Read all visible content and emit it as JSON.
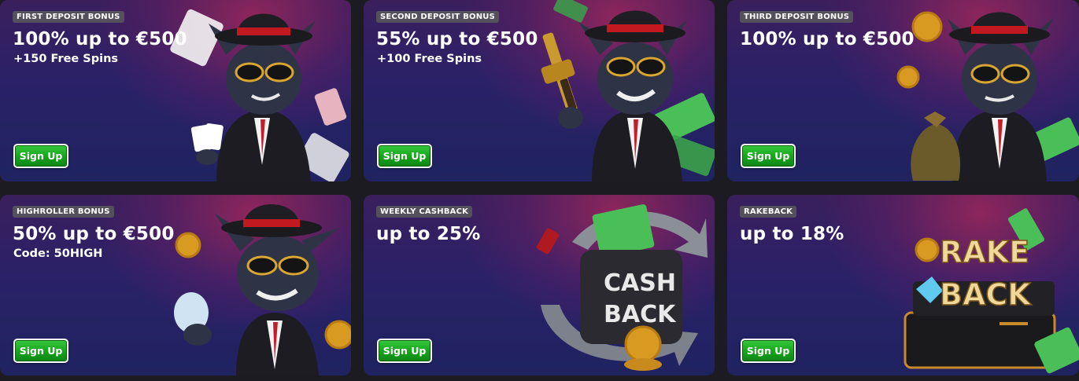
{
  "cards": [
    {
      "badge": "FIRST DEPOSIT BONUS",
      "headline": "100% up to €500",
      "sub": "+150 Free Spins",
      "button": "Sign Up",
      "art": "cat-mobster-cards"
    },
    {
      "badge": "SECOND DEPOSIT BONUS",
      "headline": "55% up to €500",
      "sub": "+100 Free Spins",
      "button": "Sign Up",
      "art": "cat-mobster-rifle"
    },
    {
      "badge": "THIRD DEPOSIT BONUS",
      "headline": "100% up to €500",
      "sub": "",
      "button": "Sign Up",
      "art": "cat-mobster-moneybag"
    },
    {
      "badge": "HIGHROLLER BONUS",
      "headline": "50% up to €500",
      "sub": "Code: 50HIGH",
      "button": "Sign Up",
      "art": "cat-mobster-diamond"
    },
    {
      "badge": "WEEKLY CASHBACK",
      "headline": "up to 25%",
      "sub": "",
      "button": "Sign Up",
      "art": "cashback-emblem",
      "art_text": [
        "CASH",
        "BACK"
      ]
    },
    {
      "badge": "RAKEBACK",
      "headline": "up to 18%",
      "sub": "",
      "button": "Sign Up",
      "art": "rakeback-briefcase",
      "art_text": [
        "RAKE",
        "BACK"
      ]
    }
  ],
  "colors": {
    "button_green": "#1fae25",
    "badge_bg": "#55515c",
    "page_bg": "#1b1b21"
  }
}
